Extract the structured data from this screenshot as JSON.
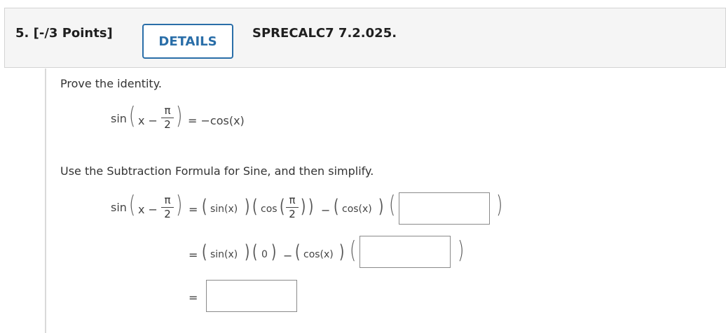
{
  "header": {
    "question_number": "5. [-/3 Points]",
    "details_label": "DETAILS",
    "problem_code": "SPRECALC7 7.2.025."
  },
  "content": {
    "instruction1": "Prove the identity.",
    "instruction2": "Use the Subtraction Formula for Sine, and then simplify."
  },
  "math": {
    "sin": "sin",
    "x_minus": "x −",
    "pi": "π",
    "two": "2",
    "equals": "=",
    "neg_cos_x": "= −cos(x)",
    "sin_x": "sin(x)",
    "cos_x": "cos(x)",
    "cos": "cos",
    "minus": "−",
    "zero": "0"
  },
  "answers": {
    "box1": "",
    "box2": "",
    "box3": ""
  }
}
